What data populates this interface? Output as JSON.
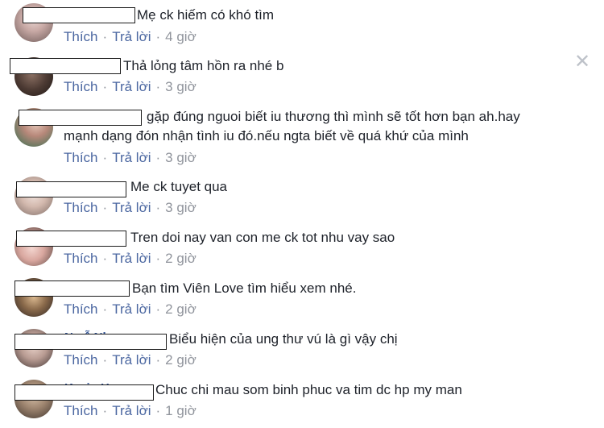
{
  "close_icon": "close-icon",
  "actions": {
    "like": "Thích",
    "reply": "Trả lời"
  },
  "comments": [
    {
      "text": "Mẹ ck hiếm có khó tìm",
      "time": "4 giờ"
    },
    {
      "text": "Thả lỏng tâm hồn ra nhé b",
      "time": "3 giờ"
    },
    {
      "text": "gặp đúng nguoi biết iu thương thì mình sẽ tốt hơn bạn ah.hay",
      "text2": "mạnh dạng đón nhận tình iu đó.nếu ngta biết về quá khứ của mình",
      "time": "3 giờ"
    },
    {
      "text": "Me ck tuyet qua",
      "time": "3 giờ"
    },
    {
      "text": "Tren doi nay van con me ck tot nhu vay sao",
      "time": "2 giờ"
    },
    {
      "text": "Bạn tìm Viên Love tìm hiểu xem nhé.",
      "time": "2 giờ"
    },
    {
      "text": "Biểu hiện của ung thư vú là gì vậy chị",
      "time": "2 giờ"
    },
    {
      "text": "Chuc chi mau som binh phuc va tim dc hp my man",
      "time": "1 giờ"
    }
  ]
}
